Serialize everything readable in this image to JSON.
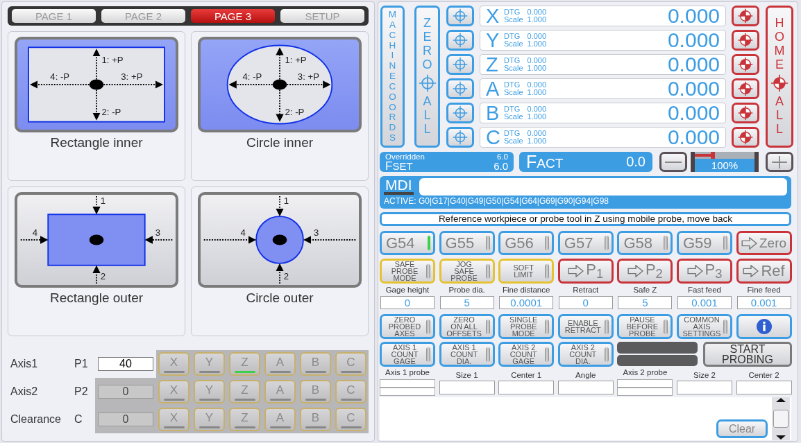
{
  "tabs": [
    {
      "label": "PAGE 1",
      "selected": false
    },
    {
      "label": "PAGE 2",
      "selected": false
    },
    {
      "label": "PAGE 3",
      "selected": true
    },
    {
      "label": "SETUP",
      "selected": false
    }
  ],
  "probe_modes": [
    {
      "label": "Rectangle inner",
      "kind": "rect-inner",
      "selected": true,
      "marks": [
        "1: +P",
        "4: -P",
        "3: +P",
        "2: -P"
      ]
    },
    {
      "label": "Circle inner",
      "kind": "circle-inner",
      "selected": true,
      "marks": [
        "1: +P",
        "4: -P",
        "3: +P",
        "2: -P"
      ]
    },
    {
      "label": "Rectangle outer",
      "kind": "rect-outer",
      "selected": false,
      "marks": [
        "1",
        "4",
        "3",
        "2"
      ]
    },
    {
      "label": "Circle outer",
      "kind": "circle-outer",
      "selected": false,
      "marks": [
        "1",
        "4",
        "3",
        "2"
      ]
    }
  ],
  "axis_settings": [
    {
      "name": "Axis1",
      "param": "P1",
      "value": "40",
      "disabled": false,
      "axes": [
        {
          "label": "X",
          "selected": false
        },
        {
          "label": "Y",
          "selected": false
        },
        {
          "label": "Z",
          "selected": true
        },
        {
          "label": "A",
          "selected": false
        },
        {
          "label": "B",
          "selected": false
        },
        {
          "label": "C",
          "selected": false
        }
      ]
    },
    {
      "name": "Axis2",
      "param": "P2",
      "value": "0",
      "disabled": true,
      "axes": [
        {
          "label": "X",
          "selected": false
        },
        {
          "label": "Y",
          "selected": false
        },
        {
          "label": "Z",
          "selected": false
        },
        {
          "label": "A",
          "selected": false
        },
        {
          "label": "B",
          "selected": false
        },
        {
          "label": "C",
          "selected": false
        }
      ]
    },
    {
      "name": "Clearance",
      "param": "C",
      "value": "0",
      "disabled": true,
      "axes": [
        {
          "label": "X",
          "selected": false
        },
        {
          "label": "Y",
          "selected": false
        },
        {
          "label": "Z",
          "selected": false
        },
        {
          "label": "A",
          "selected": false
        },
        {
          "label": "B",
          "selected": false
        },
        {
          "label": "C",
          "selected": false
        }
      ]
    }
  ],
  "coords_button": "MACHINE COORDS",
  "zero_all": {
    "top": "ZERO",
    "bottom": "ALL"
  },
  "home_all": {
    "top": "HOME",
    "bottom": "ALL"
  },
  "axes": [
    {
      "letter": "X",
      "dtg_label": "DTG",
      "dtg": "0.000",
      "scale_label": "Scale",
      "scale": "1.000",
      "value": "0.000"
    },
    {
      "letter": "Y",
      "dtg_label": "DTG",
      "dtg": "0.000",
      "scale_label": "Scale",
      "scale": "1.000",
      "value": "0.000"
    },
    {
      "letter": "Z",
      "dtg_label": "DTG",
      "dtg": "0.000",
      "scale_label": "Scale",
      "scale": "1.000",
      "value": "0.000"
    },
    {
      "letter": "A",
      "dtg_label": "DTG",
      "dtg": "0.000",
      "scale_label": "Scale",
      "scale": "1.000",
      "value": "0.000"
    },
    {
      "letter": "B",
      "dtg_label": "DTG",
      "dtg": "0.000",
      "scale_label": "Scale",
      "scale": "1.000",
      "value": "0.000"
    },
    {
      "letter": "C",
      "dtg_label": "DTG",
      "dtg": "0.000",
      "scale_label": "Scale",
      "scale": "1.000",
      "value": "0.000"
    }
  ],
  "feed": {
    "overridden_label": "Overridden",
    "overridden": "6.0",
    "fset_label": "FSET",
    "fset": "6.0",
    "fact_label": "FACT",
    "fact": "0.0"
  },
  "feed_override": {
    "level": 0.3,
    "reading": "100%"
  },
  "mdi": {
    "label": "MDI",
    "active": "ACTIVE: G0|G17|G40|G49|G50|G54|G64|G69|G90|G94|G98"
  },
  "message": "Reference workpiece or probe tool in Z using mobile probe, move back",
  "work_offsets": [
    {
      "label": "G54",
      "selected": true
    },
    {
      "label": "G55",
      "selected": false
    },
    {
      "label": "G56",
      "selected": false
    },
    {
      "label": "G57",
      "selected": false
    },
    {
      "label": "G58",
      "selected": false
    },
    {
      "label": "G59",
      "selected": false
    }
  ],
  "zero_button": "Zero",
  "mode_toggles": [
    {
      "label": "SAFE\nPROBE\nMODE",
      "on": false
    },
    {
      "label": "JOG\nSAFE\nPROBE",
      "on": false
    },
    {
      "label": "SOFT\nLIMIT",
      "on": false
    }
  ],
  "goto_buttons": [
    "P$_{1}$",
    "P$_{2}$",
    "P$_{3}$",
    "Ref"
  ],
  "parameters": [
    {
      "label": "Gage height",
      "value": "0"
    },
    {
      "label": "Probe dia.",
      "value": "5"
    },
    {
      "label": "Fine distance",
      "value": "0.0001"
    },
    {
      "label": "Retract",
      "value": "0"
    },
    {
      "label": "Safe Z",
      "value": "5"
    },
    {
      "label": "Fast feed",
      "value": "0.001"
    },
    {
      "label": "Fine feed",
      "value": "0.001"
    }
  ],
  "option_toggles": [
    {
      "label": "ZERO\nPROBED\nAXES",
      "on": false
    },
    {
      "label": "ZERO\nON ALL\nOFFSETS",
      "on": false
    },
    {
      "label": "SINGLE\nPROBE\nMODE",
      "on": false
    },
    {
      "label": "ENABLE\nRETRACT",
      "on": false
    },
    {
      "label": "PAUSE\nBEFORE\nPROBE",
      "on": false
    },
    {
      "label": "COMMON\nAXIS\nSETTINGS",
      "on": false
    }
  ],
  "count_toggles": [
    {
      "label": "AXIS 1\nCOUNT\nGAGE",
      "on": false
    },
    {
      "label": "AXIS 1\nCOUNT\nDIA.",
      "on": false
    },
    {
      "label": "AXIS 2\nCOUNT\nGAGE",
      "on": false
    },
    {
      "label": "AXIS 2\nCOUNT\nDIA.",
      "on": false
    }
  ],
  "start_button": "START\nPROBING",
  "results": [
    {
      "label": "Axis 1 probe",
      "kind": "double"
    },
    {
      "label": "Size 1",
      "kind": "single"
    },
    {
      "label": "Center 1",
      "kind": "single"
    },
    {
      "label": "Angle",
      "kind": "single"
    },
    {
      "label": "Axis 2 probe",
      "kind": "double"
    },
    {
      "label": "Size 2",
      "kind": "single"
    },
    {
      "label": "Center 2",
      "kind": "single"
    }
  ],
  "output": {
    "clear_button": "Clear"
  }
}
